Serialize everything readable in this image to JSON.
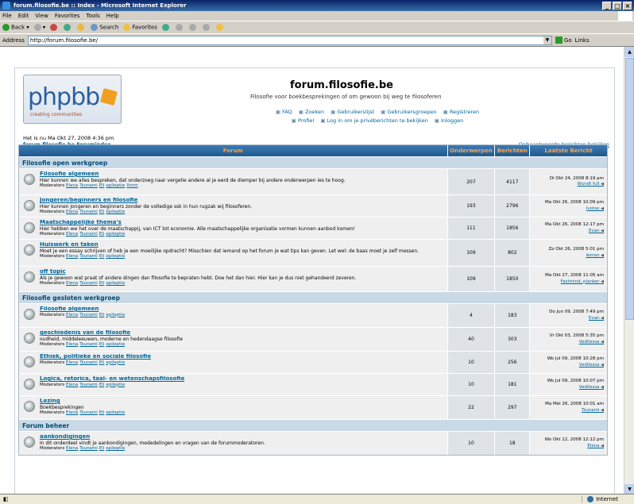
{
  "browser": {
    "window_title": "forum.filosofie.be :: Index - Microsoft Internet Explorer",
    "menu": [
      "File",
      "Edit",
      "View",
      "Favorites",
      "Tools",
      "Help"
    ],
    "toolbar": {
      "back": "Back",
      "search": "Search",
      "favorites": "Favorites"
    },
    "address_label": "Address",
    "address_value": "http://forum.filosofie.be/",
    "go_label": "Go",
    "links_label": "Links",
    "status_zone": "Internet"
  },
  "forum": {
    "logo_text": "phpbb",
    "logo_sub": "creating communities",
    "title": "forum.filosofie.be",
    "description": "Filosofie voor boekbesprekingen of om gewoon bij weg te filosoferen",
    "links_row1": [
      "FAQ",
      "Zoeken",
      "Gebruikerslijst",
      "Gebruikersgroepen",
      "Registreren"
    ],
    "links_row2": [
      "Profiel",
      "Log in om je privéberichten te bekijken",
      "Inloggen"
    ],
    "current_time": "Het is nu Ma Okt 27, 2008 4:36 pm",
    "home_link": "forum.filosofie.be Forumindex",
    "unanswered": "Onbeantwoorde berichten bekijken"
  },
  "table": {
    "headers": {
      "forum": "Forum",
      "topics": "Onderwerpen",
      "posts": "Berichten",
      "last": "Laatste Bericht"
    },
    "mods_label": "Moderators",
    "categories": [
      {
        "name": "Filosofie open werkgroep",
        "forums": [
          {
            "name": "Filosofie algemeen",
            "desc": "Hier kunnen we alles bespreken, dat onderzoeg naar vergelie andere al je eerd de diemper bij andere onderwerpen ies te hoog.",
            "mods": [
              "Elena",
              "Tsunami",
              "Eli",
              "epileptie",
              "Xmm"
            ],
            "topics": "207",
            "posts": "4117",
            "last_date": "Di Okt 24, 2008 8:19 pm",
            "last_user": "Wundt full"
          },
          {
            "name": "Jongeren/beginners en filosofie",
            "desc": "Hier kunnen jongeren en beginners zonder de volledige ssk in hun rugzak wij filosoferen.",
            "mods": [
              "Elena",
              "Tsunami",
              "Eli",
              "epileptie"
            ],
            "topics": "193",
            "posts": "2796",
            "last_date": "Ma Okt 26, 2008 10:09 pm",
            "last_user": "Ivotso"
          },
          {
            "name": "Maatschappelijke thema's",
            "desc": "Hier hebben we het over de maatschappij, van ICT tot economie. Alle maatschappelijke organisatie vormen kunnen aanbod komen!",
            "mods": [
              "Elena",
              "Tsunami",
              "Eli",
              "epileptie"
            ],
            "topics": "111",
            "posts": "1856",
            "last_date": "Ma Okt 26, 2008 12:17 pm",
            "last_user": "Evan"
          },
          {
            "name": "Huiswerk en taken",
            "desc": "Moet je een essay schrijven of heb je een moeilijke opdracht? Misschien dat iemand op het forum je wat tips kan geven. Let wel: de baas moet je zelf messen.",
            "mods": [
              "Elena",
              "Tsunami",
              "Eli",
              "epileptie"
            ],
            "topics": "109",
            "posts": "802",
            "last_date": "Zo Okt 26, 2008 5:01 pm",
            "last_user": "lemon"
          },
          {
            "name": "off topic",
            "desc": "Als je gewoon wat praat of andere dingen dan filosofie te bepraten hebt. Doe het dan hier. Hier kan je dus niet gehandeerd zeveren.",
            "mods": [
              "Elena",
              "Tsunami",
              "Eli",
              "epileptie"
            ],
            "topics": "109",
            "posts": "1850",
            "last_date": "Ma Okt 27, 2008 11:05 am",
            "last_user": "Fastmind, planker"
          }
        ]
      },
      {
        "name": "Filosofie gesloten werkgroep",
        "forums": [
          {
            "name": "Filosofie algemeen",
            "desc": "",
            "mods": [
              "Elena",
              "Tsunami",
              "Eli",
              "epileptie"
            ],
            "topics": "4",
            "posts": "183",
            "last_date": "Do Jun 09, 2008 7:49 pm",
            "last_user": "Evan"
          },
          {
            "name": "geschiedenis van de filosofie",
            "desc": "oudheid, middeleeuwen, moderne en hedendaagse filosofie",
            "mods": [
              "Elena",
              "Tsunami",
              "Eli",
              "epileptie"
            ],
            "topics": "40",
            "posts": "303",
            "last_date": "Vr Okt 03, 2008 5:35 pm",
            "last_user": "Vedllessa"
          },
          {
            "name": "Ethiek, politieke en sociale filosofie",
            "desc": "",
            "mods": [
              "Elena",
              "Tsunami",
              "Eli",
              "epileptie"
            ],
            "topics": "10",
            "posts": "256",
            "last_date": "Wo Jul 09, 2008 10:28 pm",
            "last_user": "Vedllessa"
          },
          {
            "name": "Logica, retorica, taal- en wetenschapsfilosofie",
            "desc": "",
            "mods": [
              "Elena",
              "Tsunami",
              "Eli",
              "epileptie"
            ],
            "topics": "10",
            "posts": "181",
            "last_date": "Wo Jul 09, 2008 10:07 pm",
            "last_user": "Vedllessa"
          },
          {
            "name": "Lezing",
            "desc": "Boekbesprekingen",
            "mods": [
              "Elena",
              "Tsunami",
              "Eli",
              "epileptie"
            ],
            "topics": "22",
            "posts": "297",
            "last_date": "Ma Mei 26, 2008 10:01 am",
            "last_user": "Tsunami"
          }
        ]
      },
      {
        "name": "Forum beheer",
        "forums": [
          {
            "name": "aankondigingen",
            "desc": "In dit onderdeel vindt je aankondigingen, mededelingen en vragen van de forummoderatoren.",
            "mods": [
              "Elena",
              "Tsunami",
              "Eli",
              "epileptie"
            ],
            "topics": "10",
            "posts": "18",
            "last_date": "Wo Okt 12, 2008 12:12 pm",
            "last_user": "Elena"
          }
        ]
      }
    ]
  }
}
